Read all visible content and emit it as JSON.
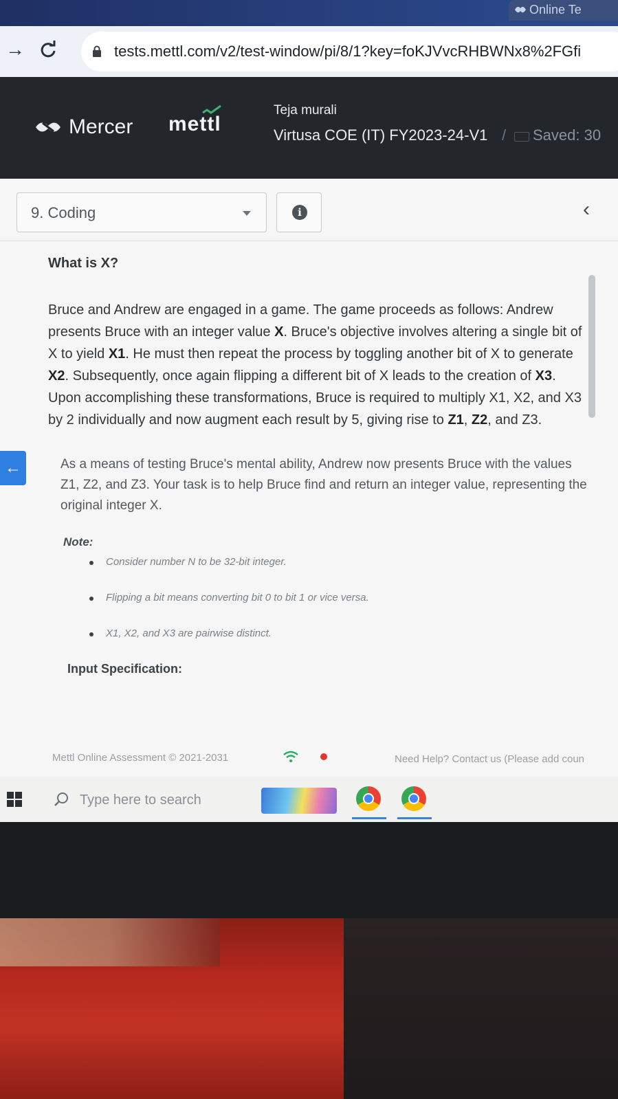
{
  "browser": {
    "tab_title": "Online Te",
    "url": "tests.mettl.com/v2/test-window/pi/8/1?key=foKJVvcRHBWNx8%2FGfi"
  },
  "header": {
    "mercer_logo": "Mercer",
    "mettl_logo": "mettl",
    "user_name": "Teja murali",
    "test_name": "Virtusa COE (IT) FY2023-24-V1",
    "separator": "/",
    "saved_status": "Saved: 30"
  },
  "toolbar": {
    "section_selected": "9. Coding"
  },
  "question": {
    "title": "What is X?",
    "para1": [
      {
        "t": "Bruce and Andrew are engaged in a game. The game proceeds as follows: Andrew presents Bruce with an integer value "
      },
      {
        "t": "X",
        "b": true
      },
      {
        "t": ". Bruce's objective involves altering a single bit of X to yield "
      },
      {
        "t": "X1",
        "b": true
      },
      {
        "t": ". He must then repeat the process by toggling another bit of X to generate "
      },
      {
        "t": "X2",
        "b": true
      },
      {
        "t": ". Subsequently, once again flipping a different bit of X leads to the creation of "
      },
      {
        "t": "X3",
        "b": true
      },
      {
        "t": ". Upon accomplishing these transformations, Bruce is required to multiply X1, X2, and X3 by 2 individually and now augment each result by 5, giving rise to "
      },
      {
        "t": "Z1",
        "b": true
      },
      {
        "t": ", "
      },
      {
        "t": "Z2",
        "b": true
      },
      {
        "t": ", and Z3."
      }
    ],
    "para2": "As a means of testing Bruce's mental ability, Andrew now presents Bruce with the values Z1, Z2, and Z3. Your task is to help Bruce find and return an integer value, representing the original integer X.",
    "note_label": "Note:",
    "notes": [
      "Consider number N to be 32-bit integer.",
      "Flipping a bit means converting bit 0 to bit 1 or vice versa.",
      "X1, X2, and X3 are pairwise distinct."
    ],
    "input_spec_label": "Input Specification:"
  },
  "footer": {
    "copyright": "Mettl Online Assessment © 2021-2031",
    "help": "Need Help? Contact us (Please add coun"
  },
  "taskbar": {
    "search_placeholder": "Type here to search"
  },
  "icons": {
    "back": "arrow-left-icon",
    "reload": "reload-icon",
    "lock": "lock-icon",
    "info": "info-icon",
    "collapse": "chevron-left-icon",
    "wifi": "wifi-icon",
    "windows": "windows-logo-icon",
    "search": "search-icon",
    "chrome": "chrome-icon"
  },
  "colors": {
    "header_bg": "#23272b",
    "accent_blue": "#2f7fe3",
    "content_bg": "#f5f6f5"
  }
}
